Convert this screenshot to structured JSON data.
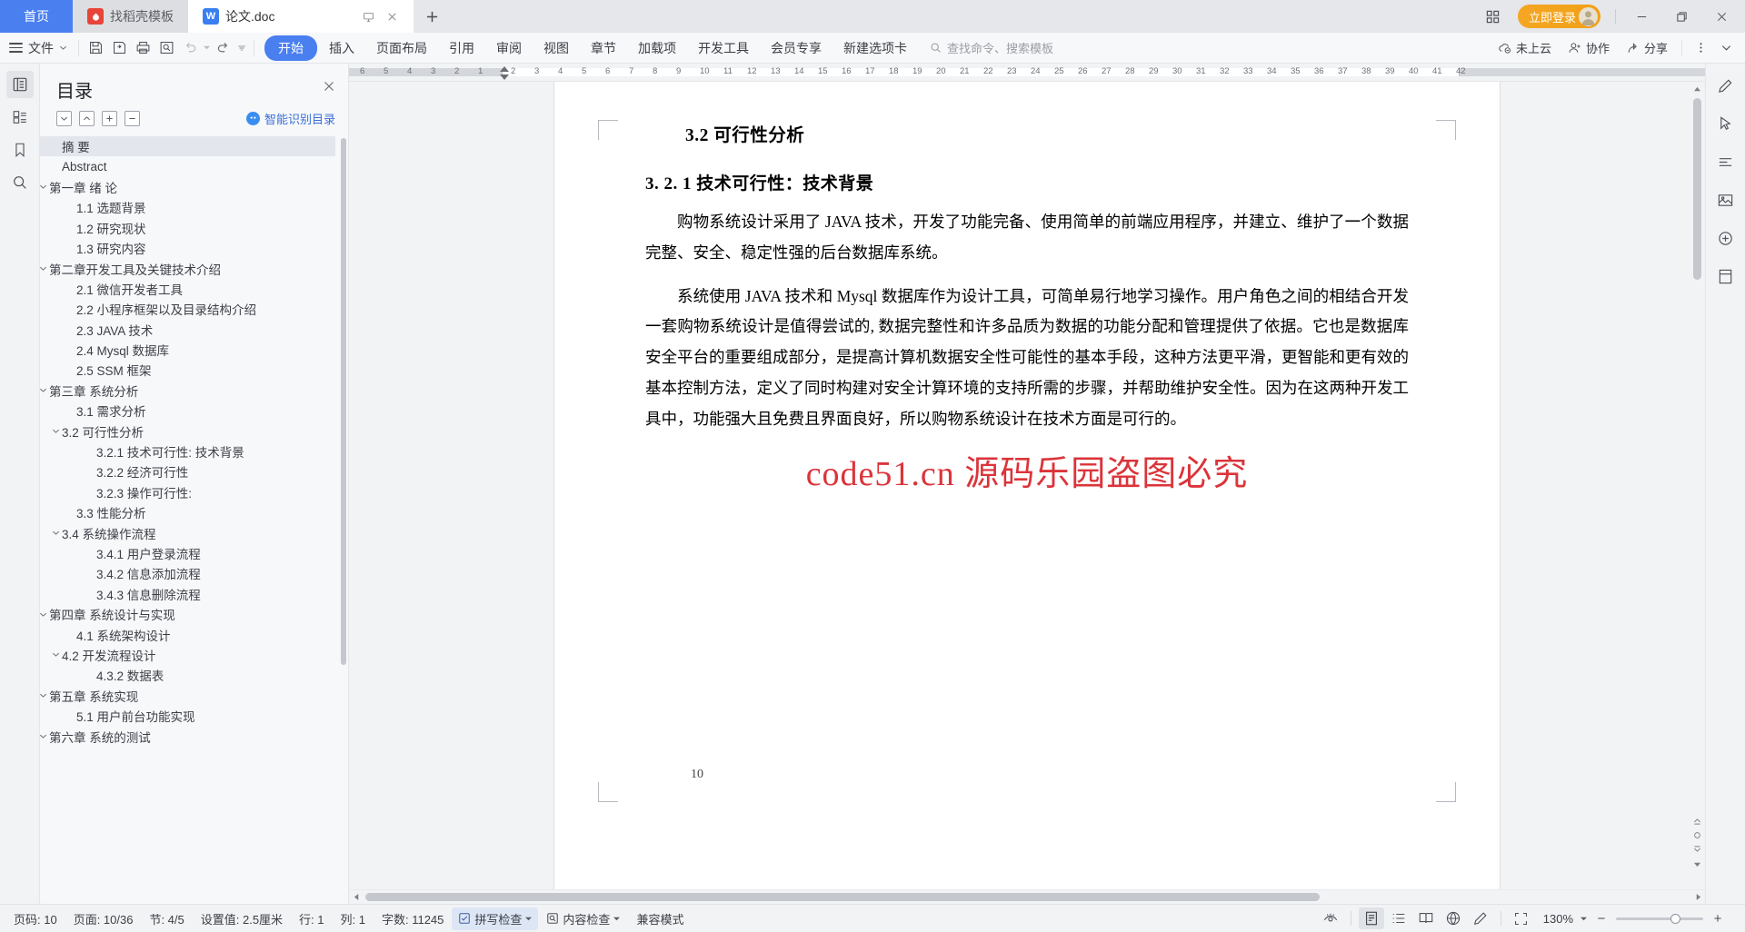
{
  "tabbar": {
    "home_label": "首页",
    "tabs": [
      {
        "label": "找稻壳模板",
        "icon": "wps-docer-icon",
        "state": "inactive"
      },
      {
        "label": "论文.doc",
        "icon": "wps-writer-icon",
        "state": "active"
      }
    ],
    "new_tab_label": "+",
    "login_label": "立即登录",
    "minimize_label": "–",
    "restore_label": "❐",
    "close_label": "✕"
  },
  "ribbon": {
    "file_label": "文件",
    "quick_icons": [
      "save-icon",
      "save-as-icon",
      "print-icon",
      "print-preview-icon",
      "undo-icon",
      "redo-icon",
      "customize-icon"
    ],
    "menus": [
      {
        "label": "开始",
        "active": true
      },
      {
        "label": "插入",
        "active": false
      },
      {
        "label": "页面布局",
        "active": false
      },
      {
        "label": "引用",
        "active": false
      },
      {
        "label": "审阅",
        "active": false
      },
      {
        "label": "视图",
        "active": false
      },
      {
        "label": "章节",
        "active": false
      },
      {
        "label": "加载项",
        "active": false
      },
      {
        "label": "开发工具",
        "active": false
      },
      {
        "label": "会员专享",
        "active": false
      },
      {
        "label": "新建选项卡",
        "active": false
      }
    ],
    "search_placeholder": "查找命令、搜索模板",
    "cloud_label": "未上云",
    "collab_label": "协作",
    "share_label": "分享"
  },
  "navpane": {
    "title": "目录",
    "close_label": "✕",
    "tools": [
      "expand-down-button",
      "collapse-up-button",
      "expand-all-button",
      "collapse-all-button"
    ],
    "smart_toc_label": "智能识别目录",
    "items": [
      {
        "label": "摘  要",
        "level": 1,
        "caret": "",
        "selected": true
      },
      {
        "label": "Abstract",
        "level": 1,
        "caret": "",
        "selected": false
      },
      {
        "label": "第一章 绪 论",
        "level": 0,
        "caret": "v",
        "selected": false
      },
      {
        "label": "1.1 选题背景",
        "level": 2,
        "caret": "",
        "selected": false
      },
      {
        "label": "1.2 研究现状",
        "level": 2,
        "caret": "",
        "selected": false
      },
      {
        "label": "1.3 研究内容",
        "level": 2,
        "caret": "",
        "selected": false
      },
      {
        "label": "第二章开发工具及关键技术介绍",
        "level": 0,
        "caret": "v",
        "selected": false
      },
      {
        "label": "2.1 微信开发者工具",
        "level": 2,
        "caret": "",
        "selected": false
      },
      {
        "label": "2.2 小程序框架以及目录结构介绍",
        "level": 2,
        "caret": "",
        "selected": false
      },
      {
        "label": "2.3 JAVA 技术",
        "level": 2,
        "caret": "",
        "selected": false
      },
      {
        "label": "2.4   Mysql 数据库",
        "level": 2,
        "caret": "",
        "selected": false
      },
      {
        "label": "2.5 SSM 框架",
        "level": 2,
        "caret": "",
        "selected": false
      },
      {
        "label": "第三章 系统分析",
        "level": 0,
        "caret": "v",
        "selected": false
      },
      {
        "label": "3.1 需求分析",
        "level": 2,
        "caret": "",
        "selected": false
      },
      {
        "label": "3.2 可行性分析",
        "level": 1,
        "caret": "v",
        "selected": false
      },
      {
        "label": "3.2.1 技术可行性: 技术背景",
        "level": 3,
        "caret": "",
        "selected": false
      },
      {
        "label": "3.2.2 经济可行性",
        "level": 3,
        "caret": "",
        "selected": false
      },
      {
        "label": "3.2.3 操作可行性:",
        "level": 3,
        "caret": "",
        "selected": false
      },
      {
        "label": "3.3 性能分析",
        "level": 2,
        "caret": "",
        "selected": false
      },
      {
        "label": "3.4 系统操作流程",
        "level": 1,
        "caret": "v",
        "selected": false
      },
      {
        "label": "3.4.1 用户登录流程",
        "level": 3,
        "caret": "",
        "selected": false
      },
      {
        "label": "3.4.2 信息添加流程",
        "level": 3,
        "caret": "",
        "selected": false
      },
      {
        "label": "3.4.3 信息删除流程",
        "level": 3,
        "caret": "",
        "selected": false
      },
      {
        "label": "第四章 系统设计与实现",
        "level": 0,
        "caret": "v",
        "selected": false
      },
      {
        "label": "4.1 系统架构设计",
        "level": 2,
        "caret": "",
        "selected": false
      },
      {
        "label": "4.2 开发流程设计",
        "level": 1,
        "caret": "v",
        "selected": false
      },
      {
        "label": "4.3.2 数据表",
        "level": 3,
        "caret": "",
        "selected": false
      },
      {
        "label": "第五章 系统实现",
        "level": 0,
        "caret": "v",
        "selected": false
      },
      {
        "label": "5.1 用户前台功能实现",
        "level": 2,
        "caret": "",
        "selected": false
      },
      {
        "label": "第六章  系统的测试",
        "level": 0,
        "caret": "v",
        "selected": false
      }
    ]
  },
  "ruler": {
    "left_numbers": [
      "6",
      "5",
      "4",
      "3",
      "2",
      "1"
    ],
    "numbers": [
      "2",
      "3",
      "4",
      "5",
      "6",
      "7",
      "8",
      "9",
      "10",
      "11",
      "12",
      "13",
      "14",
      "15",
      "16",
      "17",
      "18",
      "19",
      "20",
      "21",
      "22",
      "23",
      "24",
      "25",
      "26",
      "27",
      "28",
      "29",
      "30",
      "31",
      "32",
      "33",
      "34",
      "35",
      "36",
      "37",
      "38",
      "39",
      "40",
      "41",
      "42"
    ]
  },
  "document": {
    "heading2": "3.2 可行性分析",
    "heading3": "3. 2. 1 技术可行性：技术背景",
    "paragraphs": [
      "购物系统设计采用了 JAVA 技术，开发了功能完备、使用简单的前端应用程序，并建立、维护了一个数据完整、安全、稳定性强的后台数据库系统。",
      "系统使用 JAVA 技术和 Mysql 数据库作为设计工具，可简单易行地学习操作。用户角色之间的相结合开发一套购物系统设计是值得尝试的, 数据完整性和许多品质为数据的功能分配和管理提供了依据。它也是数据库安全平台的重要组成部分，是提高计算机数据安全性可能性的基本手段，这种方法更平滑，更智能和更有效的基本控制方法，定义了同时构建对安全计算环境的支持所需的步骤，并帮助维护安全性。因为在这两种开发工具中，功能强大且免费且界面良好，所以购物系统设计在技术方面是可行的。"
    ],
    "page_number": "10",
    "watermark": "code51.cn 源码乐园盗图必究"
  },
  "status": {
    "page_no_label": "页码: 10",
    "page_of_label": "页面: 10/36",
    "section_label": "节: 4/5",
    "setting_label": "设置值: 2.5厘米",
    "row_label": "行: 1",
    "col_label": "列: 1",
    "words_label": "字数: 11245",
    "spellcheck_label": "拼写检查",
    "contentcheck_label": "内容检查",
    "compat_label": "兼容模式",
    "view_icons": [
      "eye-icon",
      "page-view-icon",
      "outline-view-icon",
      "reading-view-icon",
      "web-view-icon",
      "pen-icon",
      "fullscreen-icon"
    ],
    "zoom_label": "130%",
    "zoom_minus": "−",
    "zoom_plus": "+"
  },
  "colors": {
    "accent": "#4a7ff0",
    "login": "#f0a117",
    "watermark": "#d8232a",
    "tabbar_bg": "#e6e7ea"
  }
}
